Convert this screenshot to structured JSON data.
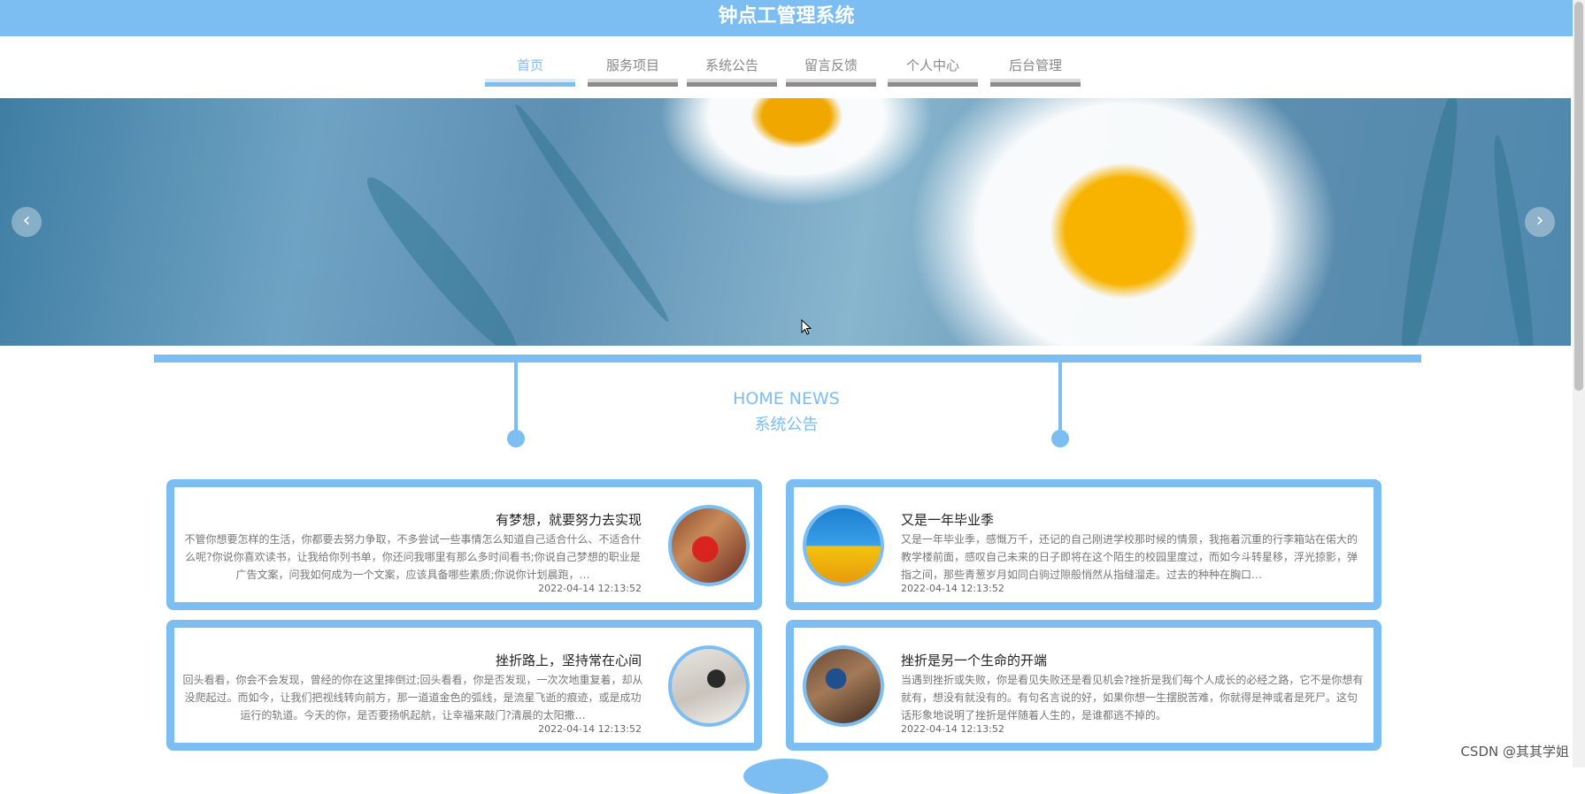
{
  "header": {
    "title": "钟点工管理系统"
  },
  "nav": {
    "items": [
      {
        "label": "首页",
        "active": true
      },
      {
        "label": "服务项目",
        "active": false
      },
      {
        "label": "系统公告",
        "active": false
      },
      {
        "label": "留言反馈",
        "active": false
      },
      {
        "label": "个人中心",
        "active": false
      },
      {
        "label": "后台管理",
        "active": false
      }
    ]
  },
  "carousel": {
    "prev_icon": "chevron-left-icon",
    "next_icon": "chevron-right-icon"
  },
  "news": {
    "heading_en": "HOME NEWS",
    "heading_zh": "系统公告",
    "items": [
      {
        "title": "有梦想，就要努力去实现",
        "summary": "不管你想要怎样的生活，你都要去努力争取，不多尝试一些事情怎么知道自己适合什么、不适合什么呢?你说你喜欢读书，让我给你列书单，你还问我哪里有那么多时间看书;你说自己梦想的职业是广告文案，问我如何成为一个文案，应该具备哪些素质;你说你计划晨跑，…",
        "date": "2022-04-14 12:13:52"
      },
      {
        "title": "又是一年毕业季",
        "summary": "又是一年毕业季，感慨万千，还记的自己刚进学校那时候的情景，我拖着沉重的行李箱站在偌大的教学楼前面，感叹自己未来的日子即将在这个陌生的校园里度过，而如今斗转星移，浮光掠影，弹指之间，那些青葱岁月如同白驹过隙般悄然从指缝溜走。过去的种种在胸口…",
        "date": "2022-04-14 12:13:52"
      },
      {
        "title": "挫折路上，坚持常在心间",
        "summary": "回头看看，你会不会发现，曾经的你在这里摔倒过;回头看看，你是否发现，一次次地重复着，却从没爬起过。而如今，让我们把视线转向前方，那一道道金色的弧线，是流星飞逝的痕迹，或是成功运行的轨道。今天的你，是否要扬帆起航，让幸福来敲门?清晨的太阳撒…",
        "date": "2022-04-14 12:13:52"
      },
      {
        "title": "挫折是另一个生命的开端",
        "summary": "当遇到挫折或失败，你是看见失败还是看见机会?挫折是我们每个人成长的必经之路，它不是你想有就有，想没有就没有的。有句名言说的好，如果你想一生摆脱苦难，你就得是神或者是死尸。这句话形象地说明了挫折是伴随着人生的，是谁都逃不掉的。",
        "date": "2022-04-14 12:13:52"
      }
    ]
  },
  "watermark": "CSDN @其其学姐",
  "colors": {
    "accent": "#7dbef2",
    "nav_inactive": "#888888"
  }
}
